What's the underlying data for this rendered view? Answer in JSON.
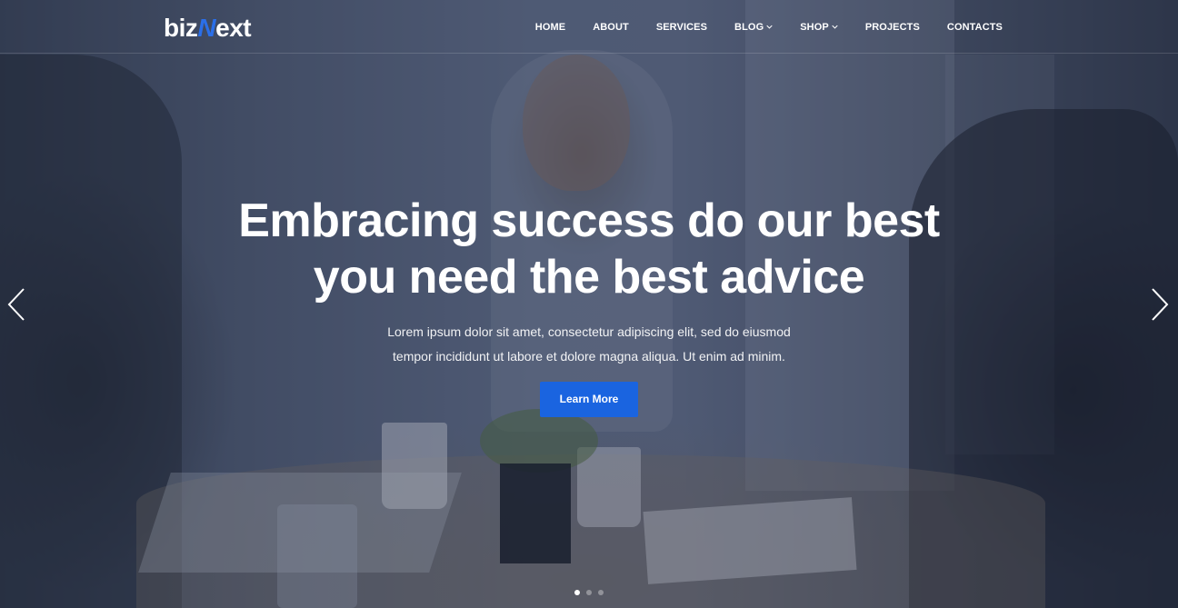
{
  "brand": {
    "logo_part1": "biz",
    "logo_accent": "N",
    "logo_part2": "ext",
    "accent_color": "#2b6fe8"
  },
  "nav": {
    "items": [
      {
        "label": "HOME",
        "has_dropdown": false
      },
      {
        "label": "ABOUT",
        "has_dropdown": false
      },
      {
        "label": "SERVICES",
        "has_dropdown": false
      },
      {
        "label": "BLOG",
        "has_dropdown": true
      },
      {
        "label": "SHOP",
        "has_dropdown": true
      },
      {
        "label": "PROJECTS",
        "has_dropdown": false
      },
      {
        "label": "CONTACTS",
        "has_dropdown": false
      }
    ]
  },
  "hero": {
    "title_line1": "Embracing success do our best",
    "title_line2": "you need the best advice",
    "description_line1": "Lorem ipsum dolor sit amet, consectetur adipiscing elit, sed do eiusmod",
    "description_line2": "tempor incididunt ut labore et dolore magna aliqua. Ut enim ad minim.",
    "button_label": "Learn More",
    "button_color": "#1a64e0"
  },
  "slider": {
    "prev_icon": "chevron-left-icon",
    "next_icon": "chevron-right-icon",
    "total_slides": 3,
    "active_slide": 1
  }
}
